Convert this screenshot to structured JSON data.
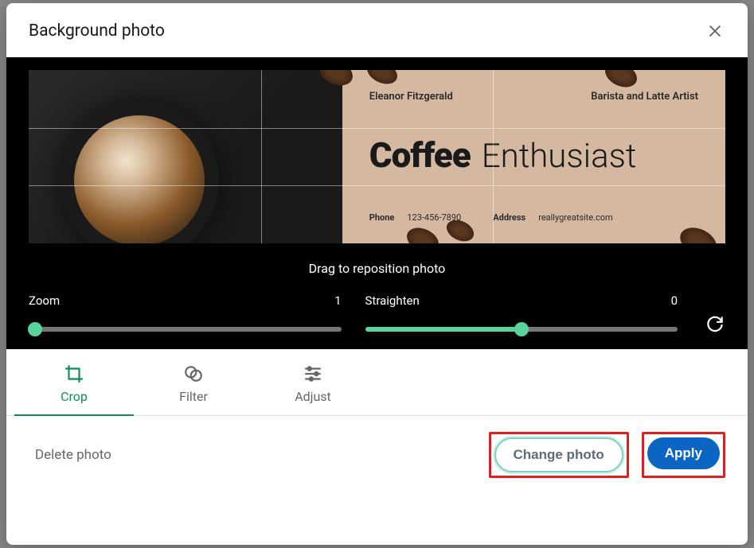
{
  "header": {
    "title": "Background photo"
  },
  "photo": {
    "name": "Eleanor Fitzgerald",
    "role": "Barista and Latte Artist",
    "word1": "Coffee",
    "word2": "Enthusiast",
    "phone_label": "Phone",
    "phone_value": "123-456-7890",
    "address_label": "Address",
    "address_value": "reallygreatsite.com"
  },
  "hint": "Drag to reposition photo",
  "controls": {
    "zoom": {
      "label": "Zoom",
      "value": "1",
      "percent": 0
    },
    "straighten": {
      "label": "Straighten",
      "value": "0",
      "percent": 50
    }
  },
  "tabs": {
    "crop": "Crop",
    "filter": "Filter",
    "adjust": "Adjust"
  },
  "footer": {
    "delete": "Delete photo",
    "change": "Change photo",
    "apply": "Apply"
  }
}
